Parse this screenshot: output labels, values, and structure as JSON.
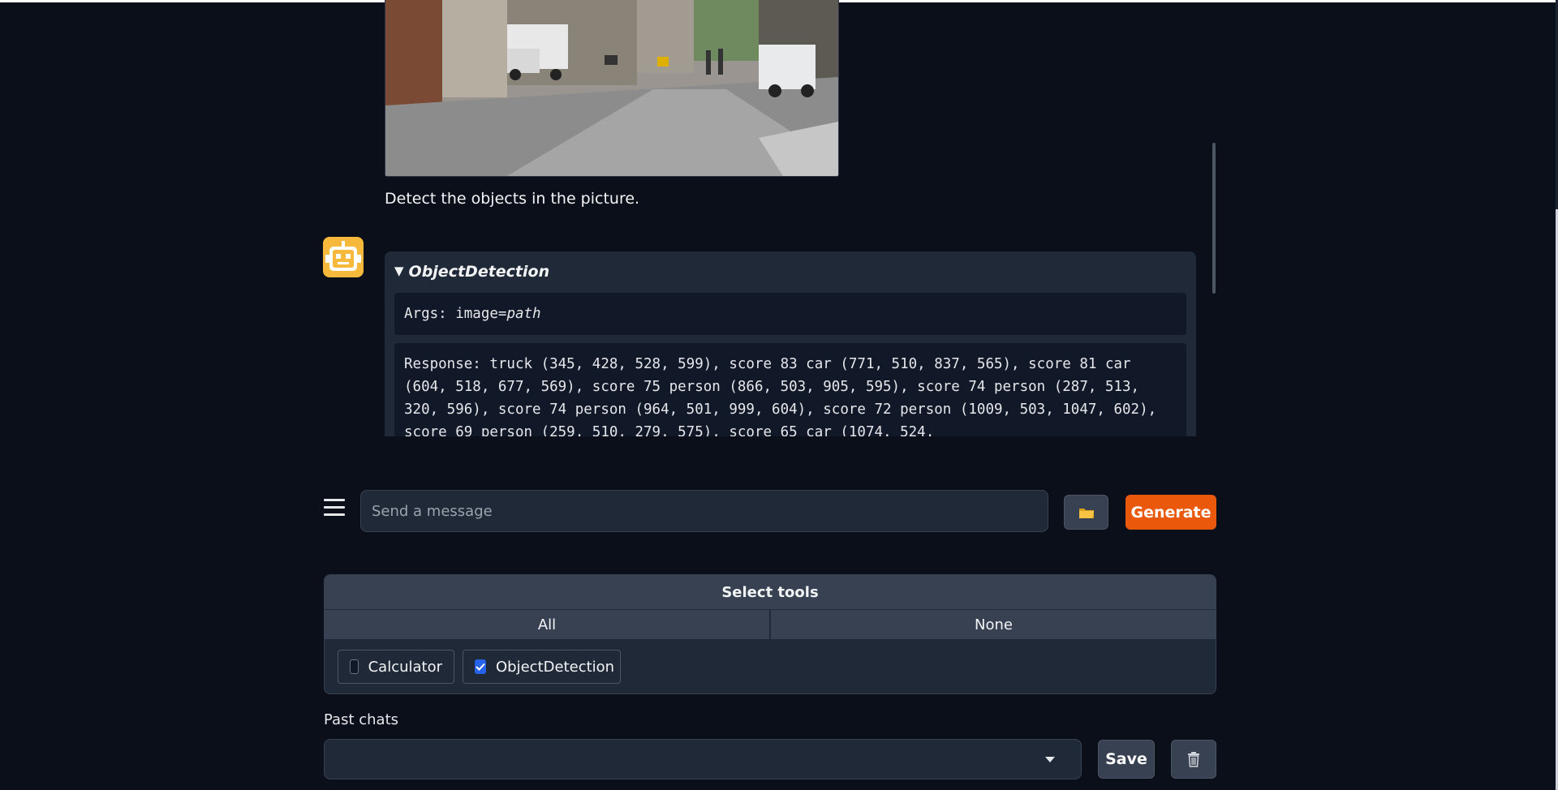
{
  "chat": {
    "user_message": "Detect the objects in the picture.",
    "user_image_icon": "street-photo-image",
    "bot_avatar_icon": "robot-icon",
    "tool_call": {
      "name": "ObjectDetection",
      "args_prefix": "Args: image=",
      "args_value": "path",
      "response": "Response: truck (345, 428, 528, 599), score 83 car (771, 510, 837, 565), score 81 car (604, 518, 677, 569), score 75 person (866, 503, 905, 595), score 74 person (287, 513, 320, 596), score 74 person (964, 501, 999, 604), score 72 person (1009, 503, 1047, 602), score 69 person (259, 510, 279, 575), score 65 car (1074, 524,"
    }
  },
  "input": {
    "placeholder": "Send a message",
    "menu_icon": "hamburger-menu-icon",
    "upload_icon": "folder-icon",
    "generate_label": "Generate"
  },
  "tools": {
    "title": "Select tools",
    "all_label": "All",
    "none_label": "None",
    "items": [
      {
        "label": "Calculator",
        "checked": false
      },
      {
        "label": "ObjectDetection",
        "checked": true
      }
    ]
  },
  "past_chats": {
    "label": "Past chats",
    "selected": "",
    "save_label": "Save",
    "delete_icon": "trash-icon"
  },
  "colors": {
    "background": "#0b0f19",
    "accent": "#ea580c",
    "checkbox": "#2563eb",
    "avatar": "#f6b93b"
  }
}
